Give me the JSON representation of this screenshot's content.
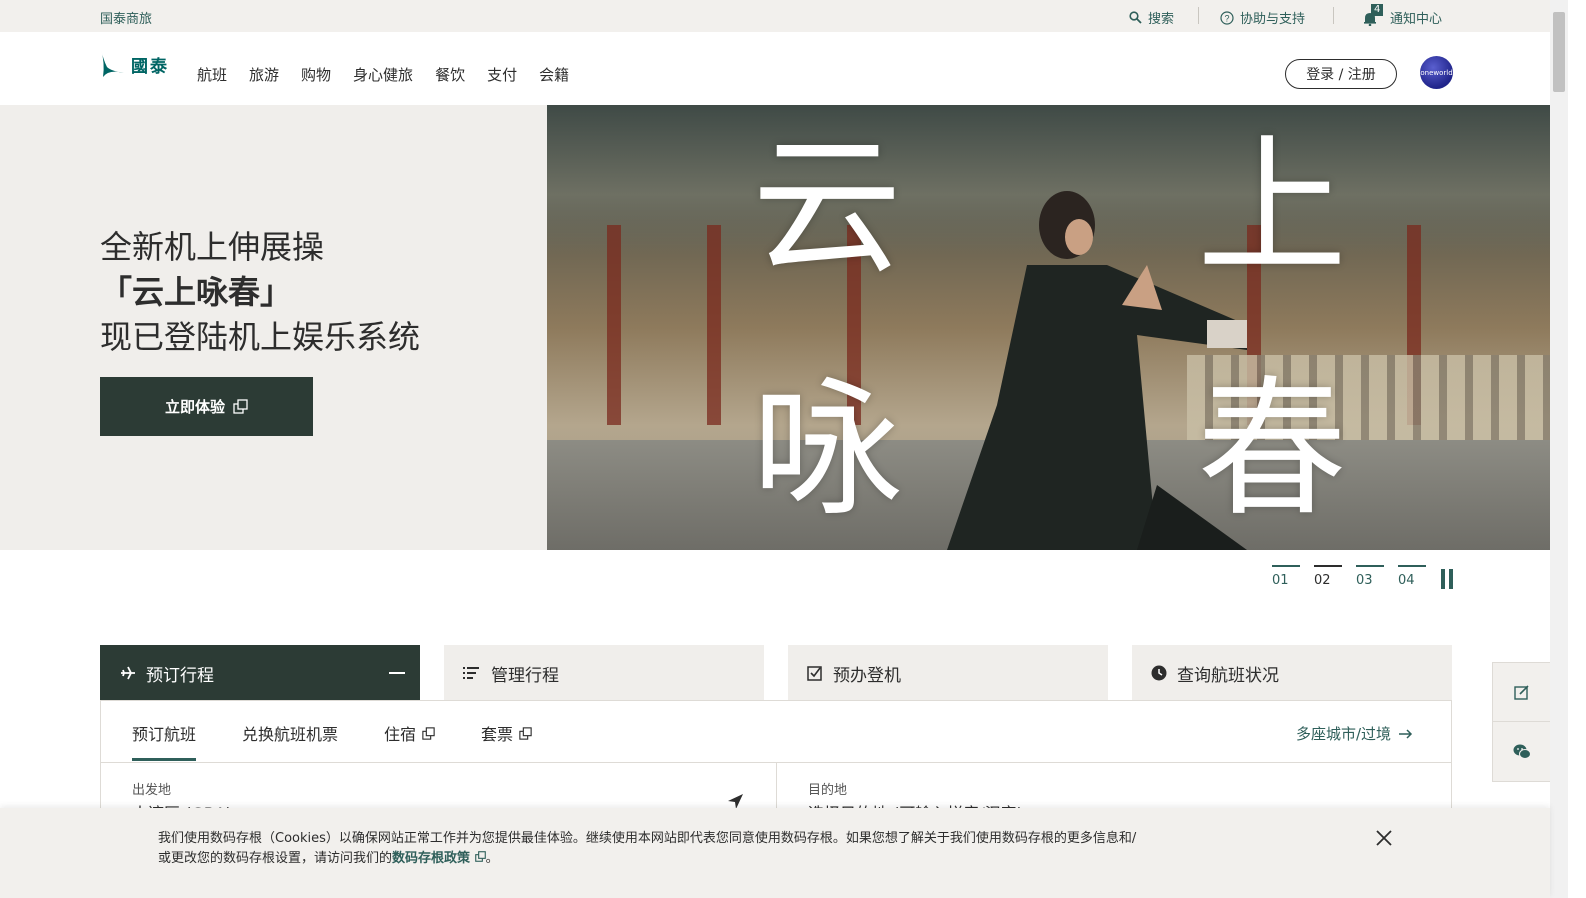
{
  "topbar": {
    "brand": "国泰商旅",
    "search": "搜索",
    "help": "协助与支持",
    "notifications": "通知中心",
    "notification_count": "4"
  },
  "header": {
    "logo_text": "國泰",
    "nav": [
      "航班",
      "旅游",
      "购物",
      "身心健旅",
      "餐饮",
      "支付",
      "会籍"
    ],
    "login": "登录 / 注册",
    "oneworld": "oneworld"
  },
  "hero": {
    "line1": "全新机上伸展操",
    "line2": "「云上咏春」",
    "line3": "现已登陆机上娱乐系统",
    "cta": "立即体验",
    "chars": [
      "云",
      "上",
      "咏",
      "春"
    ]
  },
  "carousel": {
    "slides": [
      "01",
      "02",
      "03",
      "04"
    ],
    "active_index": 1
  },
  "booking": {
    "tabs": [
      "预订行程",
      "管理行程",
      "预办登机",
      "查询航班状况"
    ],
    "subtabs": [
      "预订航班",
      "兑换航班机票",
      "住宿",
      "套票"
    ],
    "multicity": "多座城市/过境",
    "origin_label": "出发地",
    "origin_value": "大湾区 (GBA)",
    "dest_label": "目的地",
    "dest_value": "选择目的地 (可输入拼音/汉字)"
  },
  "cookie": {
    "text_before": "我们使用数码存根（Cookies）以确保网站正常工作并为您提供最佳体验。继续使用本网站即代表您同意使用数码存根。如果您想了解关于我们使用数码存根的更多信息和/或更改您的数码存根设置，请访问我们的",
    "link": "数码存根政策",
    "text_after": "。"
  },
  "colors": {
    "brand_green": "#2f5f5a",
    "dark_green": "#2c3b35",
    "panel_beige": "#f0eeeb"
  }
}
